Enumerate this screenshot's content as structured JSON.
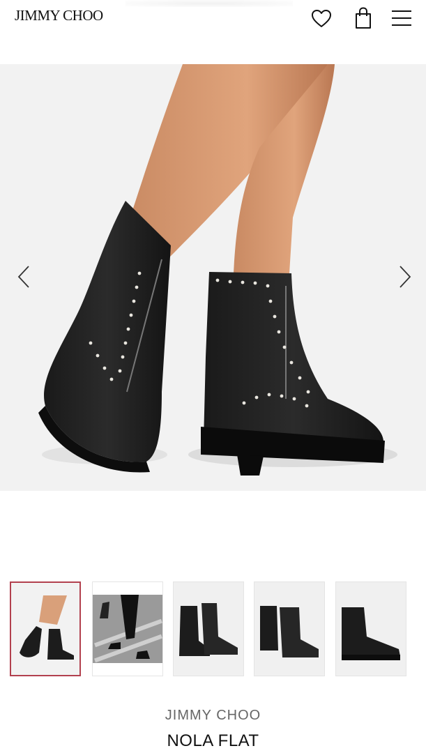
{
  "header": {
    "logo": "JIMMY CHOO",
    "icons": [
      "heart-icon",
      "shopping-bag-icon",
      "hamburger-menu-icon"
    ]
  },
  "gallery": {
    "main_image": "studded black ankle boots on model",
    "prev_icon": "chevron-left-icon",
    "next_icon": "chevron-right-icon",
    "selected_index": 0,
    "thumbnails": [
      "model wearing boots",
      "street style walking",
      "pair front view",
      "pair three-quarter view",
      "single boot side view"
    ]
  },
  "product": {
    "brand": "JIMMY CHOO",
    "name": "NOLA FLAT"
  },
  "colors": {
    "active_border": "#b2404e",
    "hero_bg": "#f2f2f2"
  }
}
